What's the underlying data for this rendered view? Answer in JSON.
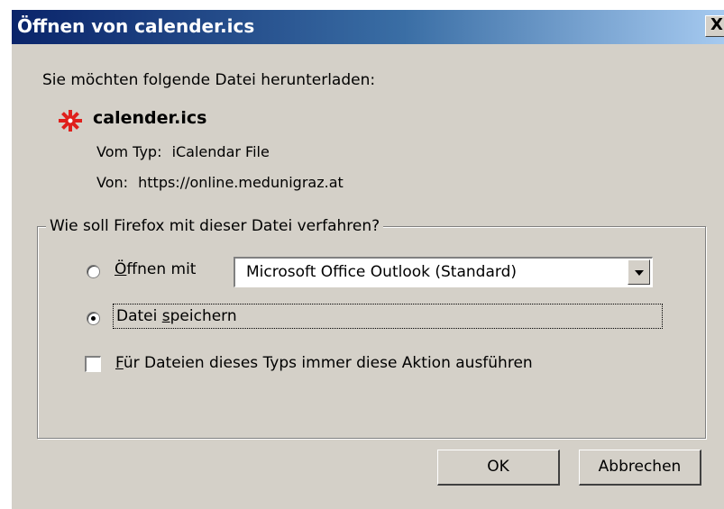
{
  "window": {
    "title": "Öffnen von calender.ics",
    "close_glyph": "X"
  },
  "prompt": "Sie möchten folgende Datei herunterladen:",
  "file": {
    "icon": "ical-file-icon",
    "name": "calender.ics",
    "type_label": "Vom Typ:",
    "type_value": "iCalendar File",
    "from_label": "Von:",
    "from_value": "https://online.medunigraz.at"
  },
  "action_group": {
    "legend": "Wie soll Firefox mit dieser Datei verfahren?",
    "open_with": {
      "label_accel": "Ö",
      "label_rest": "ffnen mit",
      "selected": false,
      "app": "Microsoft Office Outlook (Standard)"
    },
    "save_file": {
      "label_pre": "Datei ",
      "label_accel": "s",
      "label_rest": "peichern",
      "selected": true
    },
    "always": {
      "label_accel": "F",
      "label_rest": "ür Dateien dieses Typs immer diese Aktion ausführen",
      "checked": false
    }
  },
  "buttons": {
    "ok": "OK",
    "cancel": "Abbrechen"
  },
  "colors": {
    "dialog_bg": "#d4d0c8",
    "titlebar_start": "#0a246a",
    "titlebar_end": "#a6caf0",
    "icon_red": "#e0201c"
  }
}
